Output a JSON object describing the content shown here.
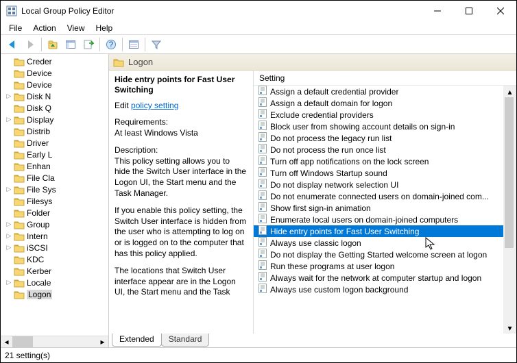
{
  "window": {
    "title": "Local Group Policy Editor"
  },
  "menu": [
    "File",
    "Action",
    "View",
    "Help"
  ],
  "tree": {
    "items": [
      {
        "label": "Creder",
        "exp": ""
      },
      {
        "label": "Device",
        "exp": ""
      },
      {
        "label": "Device",
        "exp": ""
      },
      {
        "label": "Disk N",
        "exp": "▷"
      },
      {
        "label": "Disk Q",
        "exp": ""
      },
      {
        "label": "Display",
        "exp": "▷"
      },
      {
        "label": "Distrib",
        "exp": ""
      },
      {
        "label": "Driver",
        "exp": ""
      },
      {
        "label": "Early L",
        "exp": ""
      },
      {
        "label": "Enhan",
        "exp": ""
      },
      {
        "label": "File Cla",
        "exp": ""
      },
      {
        "label": "File Sys",
        "exp": "▷"
      },
      {
        "label": "Filesys",
        "exp": ""
      },
      {
        "label": "Folder",
        "exp": ""
      },
      {
        "label": "Group",
        "exp": "▷"
      },
      {
        "label": "Intern",
        "exp": "▷"
      },
      {
        "label": "iSCSI",
        "exp": "▷"
      },
      {
        "label": "KDC",
        "exp": ""
      },
      {
        "label": "Kerber",
        "exp": ""
      },
      {
        "label": "Locale",
        "exp": "▷"
      },
      {
        "label": "Logon",
        "exp": "",
        "selected": true
      }
    ]
  },
  "header": {
    "title": "Logon"
  },
  "detail": {
    "title": "Hide entry points for Fast User Switching",
    "edit_prefix": "Edit ",
    "edit_link": "policy setting",
    "req_label": "Requirements:",
    "req_value": "At least Windows Vista",
    "desc_label": "Description:",
    "desc1": "This policy setting allows you to hide the Switch User interface in the Logon UI, the Start menu and the Task Manager.",
    "desc2": "If you enable this policy setting, the Switch User interface is hidden from the user who is attempting to log on or is logged on to the computer that has this policy applied.",
    "desc3": "The locations that Switch User interface appear are in the Logon UI, the Start menu and the Task"
  },
  "settings": {
    "column": "Setting",
    "items": [
      "Assign a default credential provider",
      "Assign a default domain for logon",
      "Exclude credential providers",
      "Block user from showing account details on sign-in",
      "Do not process the legacy run list",
      "Do not process the run once list",
      "Turn off app notifications on the lock screen",
      "Turn off Windows Startup sound",
      "Do not display network selection UI",
      "Do not enumerate connected users on domain-joined com...",
      "Show first sign-in animation",
      "Enumerate local users on domain-joined computers",
      "Hide entry points for Fast User Switching",
      "Always use classic logon",
      "Do not display the Getting Started welcome screen at logon",
      "Run these programs at user logon",
      "Always wait for the network at computer startup and logon",
      "Always use custom logon background"
    ],
    "selected_index": 12
  },
  "tabs": {
    "extended": "Extended",
    "standard": "Standard"
  },
  "status": "21 setting(s)"
}
